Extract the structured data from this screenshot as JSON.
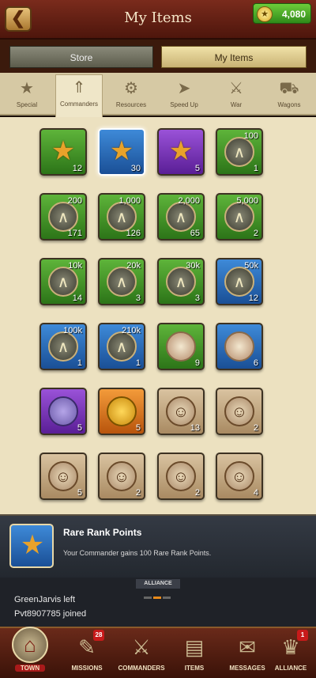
{
  "header": {
    "title": "My Items",
    "gold": "4,080"
  },
  "top_tabs": {
    "store": "Store",
    "my_items": "My Items"
  },
  "categories": [
    {
      "label": "Special",
      "icon": "star-badge-icon"
    },
    {
      "label": "Commanders",
      "icon": "rank-chevron-icon"
    },
    {
      "label": "Resources",
      "icon": "resources-icon"
    },
    {
      "label": "Speed Up",
      "icon": "speed-arrow-icon"
    },
    {
      "label": "War",
      "icon": "crossed-swords-icon"
    },
    {
      "label": "Wagons",
      "icon": "wagon-icon"
    }
  ],
  "items": [
    {
      "color": "green",
      "icon": "star",
      "top": "",
      "qty": "12"
    },
    {
      "color": "blue",
      "icon": "star",
      "top": "",
      "qty": "30",
      "selected": true
    },
    {
      "color": "purple",
      "icon": "star",
      "top": "",
      "qty": "5"
    },
    {
      "color": "green",
      "icon": "medal",
      "top": "100",
      "qty": "1"
    },
    {
      "color": "green",
      "icon": "medal",
      "top": "200",
      "qty": "171"
    },
    {
      "color": "green",
      "icon": "medal",
      "top": "1,000",
      "qty": "126"
    },
    {
      "color": "green",
      "icon": "medal",
      "top": "2,000",
      "qty": "65"
    },
    {
      "color": "green",
      "icon": "medal",
      "top": "5,000",
      "qty": "2"
    },
    {
      "color": "green",
      "icon": "medal",
      "top": "10k",
      "qty": "14"
    },
    {
      "color": "green",
      "icon": "medal",
      "top": "20k",
      "qty": "3"
    },
    {
      "color": "green",
      "icon": "medal",
      "top": "30k",
      "qty": "3"
    },
    {
      "color": "blue",
      "icon": "medal",
      "top": "50k",
      "qty": "12"
    },
    {
      "color": "blue",
      "icon": "medal",
      "top": "100k",
      "qty": "1"
    },
    {
      "color": "blue",
      "icon": "medal",
      "top": "210k",
      "qty": "1"
    },
    {
      "color": "green",
      "icon": "coinb",
      "top": "",
      "qty": "9"
    },
    {
      "color": "blue",
      "icon": "coinb",
      "top": "",
      "qty": "6"
    },
    {
      "color": "purple",
      "icon": "coinc",
      "top": "",
      "qty": "5"
    },
    {
      "color": "orange",
      "icon": "coind",
      "top": "",
      "qty": "5"
    },
    {
      "color": "sepia",
      "icon": "face",
      "top": "",
      "qty": "13"
    },
    {
      "color": "sepia",
      "icon": "face",
      "top": "",
      "qty": "2"
    },
    {
      "color": "sepia",
      "icon": "face",
      "top": "",
      "qty": "5"
    },
    {
      "color": "sepia",
      "icon": "face",
      "top": "",
      "qty": "2"
    },
    {
      "color": "sepia",
      "icon": "face",
      "top": "",
      "qty": "2"
    },
    {
      "color": "sepia",
      "icon": "face",
      "top": "",
      "qty": "4"
    }
  ],
  "info": {
    "title": "Rare Rank Points",
    "desc": "Your Commander gains 100 Rare Rank Points."
  },
  "chat": {
    "tag": "ALLIANCE",
    "lines": [
      "GreenJarvis left",
      "Pvt8907785 joined"
    ]
  },
  "nav": [
    {
      "label": "TOWN",
      "icon": "town-icon",
      "badge": ""
    },
    {
      "label": "MISSIONS",
      "icon": "missions-icon",
      "badge": "28"
    },
    {
      "label": "COMMANDERS",
      "icon": "commanders-icon",
      "badge": ""
    },
    {
      "label": "ITEMS",
      "icon": "items-icon",
      "badge": ""
    },
    {
      "label": "MESSAGES",
      "icon": "messages-icon",
      "badge": ""
    },
    {
      "label": "ALLIANCE",
      "icon": "alliance-icon",
      "badge": "1"
    }
  ]
}
